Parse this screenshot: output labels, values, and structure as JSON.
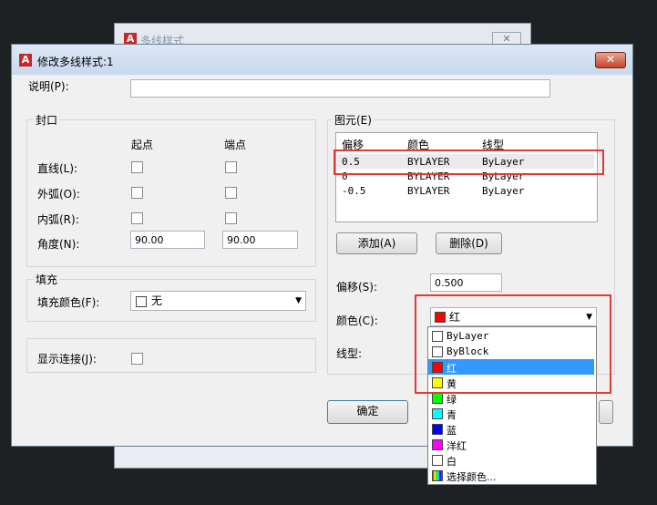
{
  "bg_window": {
    "title": "多线样式",
    "close": "✕"
  },
  "dialog": {
    "title": "修改多线样式:1",
    "close": "✕"
  },
  "description": {
    "label": "说明(P):",
    "value": ""
  },
  "caps": {
    "title": "封口",
    "start_header": "起点",
    "end_header": "端点",
    "line_label": "直线(L):",
    "outer_arc_label": "外弧(O):",
    "inner_arc_label": "内弧(R):",
    "angle_label": "角度(N):",
    "start_angle": "90.00",
    "end_angle": "90.00"
  },
  "fill": {
    "title": "填充",
    "color_label": "填充颜色(F):",
    "color_value": "无"
  },
  "joints": {
    "label": "显示连接(J):"
  },
  "elements": {
    "title": "图元(E)",
    "headers": [
      "偏移",
      "颜色",
      "线型"
    ],
    "rows": [
      {
        "offset": "0.5",
        "color": "BYLAYER",
        "linetype": "ByLayer"
      },
      {
        "offset": "0",
        "color": "BYLAYER",
        "linetype": "ByLayer"
      },
      {
        "offset": "-0.5",
        "color": "BYLAYER",
        "linetype": "ByLayer"
      }
    ],
    "add_label": "添加(A)",
    "delete_label": "删除(D)",
    "offset_label": "偏移(S):",
    "offset_value": "0.500",
    "color_label": "颜色(C):",
    "color_value": "红",
    "linetype_label": "线型:"
  },
  "ok_label": "确定",
  "color_dropdown": {
    "options": [
      {
        "label": "ByLayer",
        "swatch": "#ffffff"
      },
      {
        "label": "ByBlock",
        "swatch": "#ffffff"
      },
      {
        "label": "红",
        "swatch": "#ff0000"
      },
      {
        "label": "黄",
        "swatch": "#ffff00"
      },
      {
        "label": "绿",
        "swatch": "#00ff00"
      },
      {
        "label": "青",
        "swatch": "#00ffff"
      },
      {
        "label": "蓝",
        "swatch": "#0000ff"
      },
      {
        "label": "洋红",
        "swatch": "#ff00ff"
      },
      {
        "label": "白",
        "swatch": "#ffffff"
      },
      {
        "label": "选择颜色...",
        "swatch": "gradient"
      }
    ],
    "selected_index": 2
  },
  "colors": {
    "highlight": "#e53935",
    "selection": "#3399ff"
  }
}
